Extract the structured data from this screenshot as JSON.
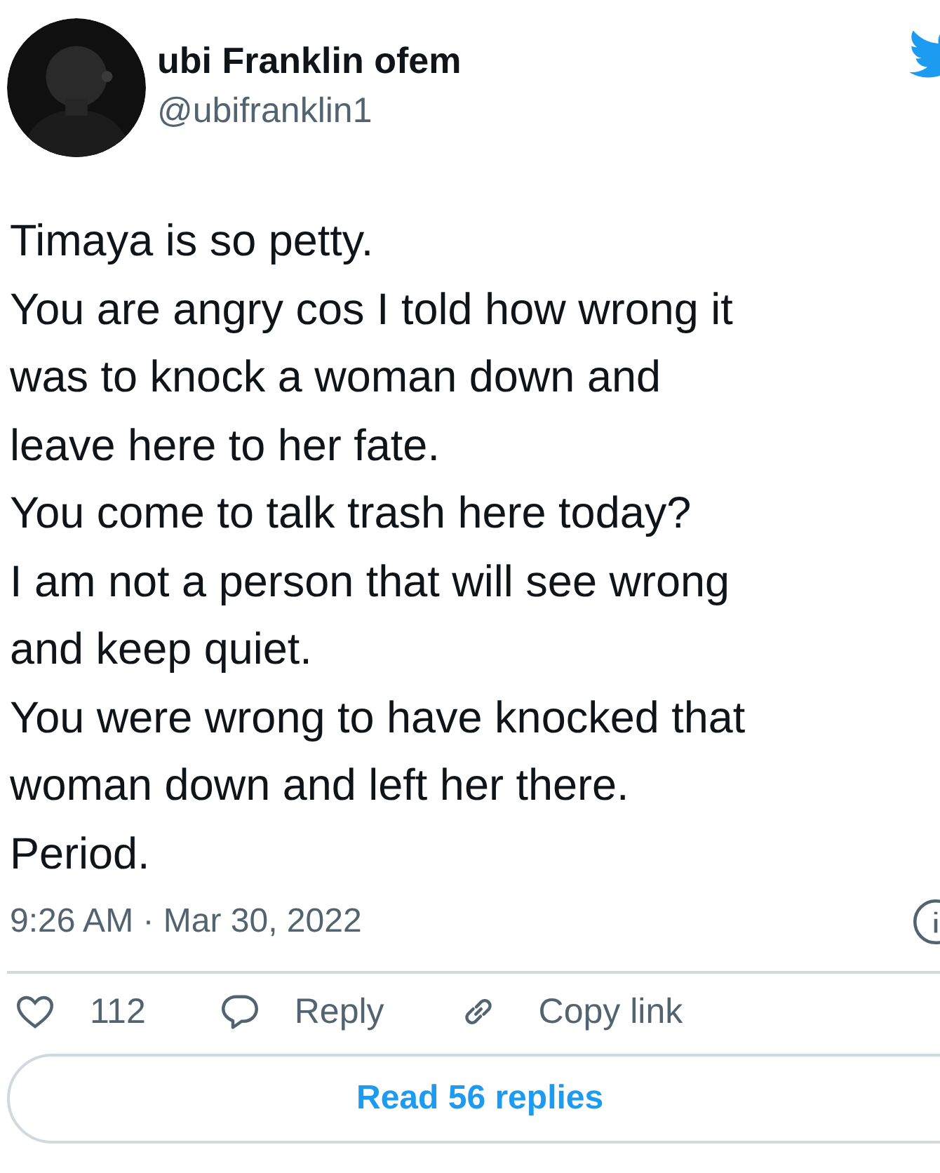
{
  "author": {
    "name": "ubi Franklin ofem",
    "handle": "@ubifranklin1"
  },
  "text_lines": [
    "Timaya is so petty.",
    "You are angry cos I told how wrong it",
    "was to knock a woman down and",
    "leave here to her fate.",
    "You come to talk trash here today?",
    "I am not a person that will see wrong",
    "and keep quiet.",
    "You were wrong to have knocked that",
    "woman down and left her there.",
    "Period."
  ],
  "timestamp": "9:26 AM · Mar 30, 2022",
  "actions": [
    {
      "kind": "like",
      "label": "112"
    },
    {
      "kind": "reply",
      "label": "Reply"
    },
    {
      "kind": "copy_link",
      "label": "Copy link"
    }
  ],
  "replies_button": "Read 56 replies"
}
